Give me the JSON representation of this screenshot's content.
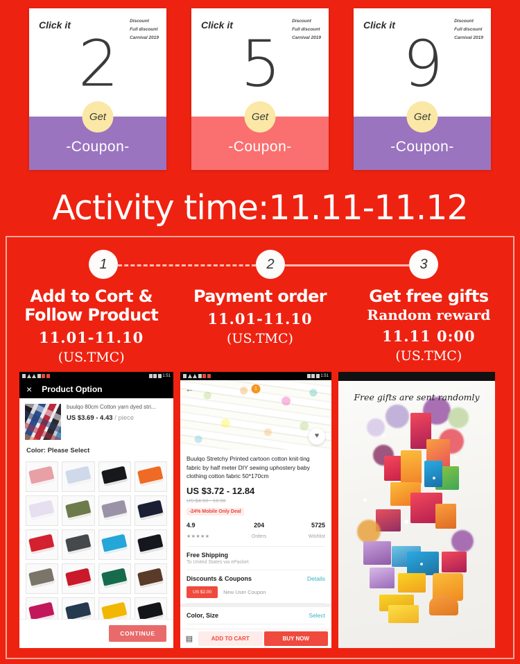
{
  "theme": {
    "background_red": "#ee2211",
    "purple": "#9a74bf",
    "coral": "#fa6f6f",
    "badge_yellow": "#fbe8a6",
    "frame_pink": "#f4a79b",
    "accent_orange_red": "#ef4a3d"
  },
  "coupons": [
    {
      "click_label": "Click it",
      "fineprint": [
        "Discount",
        "Full discount",
        "Carnival 2019"
      ],
      "amount": "2",
      "get_label": "Get",
      "coupon_label": "-Coupon-",
      "color": "purple"
    },
    {
      "click_label": "Click it",
      "fineprint": [
        "Discount",
        "Full discount",
        "Carnival 2019"
      ],
      "amount": "5",
      "get_label": "Get",
      "coupon_label": "-Coupon-",
      "color": "coral"
    },
    {
      "click_label": "Click it",
      "fineprint": [
        "Discount",
        "Full discount",
        "Carnival 2019"
      ],
      "amount": "9",
      "get_label": "Get",
      "coupon_label": "-Coupon-",
      "color": "purple"
    }
  ],
  "activity_time": "Activity time:11.11-11.12",
  "steps": [
    {
      "number": "1",
      "title": "Add to Cort &\nFollow Product",
      "subtitle": "",
      "date": "11.01-11.10",
      "region": "(US.TMC)"
    },
    {
      "number": "2",
      "title": "Payment order",
      "subtitle": "",
      "date": "11.01-11.10",
      "region": "(US.TMC)"
    },
    {
      "number": "3",
      "title": "Get free gifts",
      "subtitle": "Random reward",
      "date": "11.11  0:00",
      "region": "(US.TMC)"
    }
  ],
  "screenshot1": {
    "status_time": "1:51",
    "appbar_title": "Product Option",
    "close_icon": "×",
    "product_title": "buulqo 80cm Cotton yarn dyed stri...",
    "price": "US $3.69 - 4.43",
    "price_unit": "/ piece",
    "color_label": "Color: Please Select",
    "continue_label": "CONTINUE",
    "swatch_colors": [
      "#e8a0a6",
      "#cfd9ea",
      "#17181c",
      "#ef6a25",
      "#e6dff0",
      "#6d7a4a",
      "#9a93a8",
      "#1b1f33",
      "#d3222f",
      "#45494c",
      "#25a6d8",
      "#15171f",
      "#7b7468",
      "#c9192b",
      "#166b4c",
      "#5a3a28",
      "#c2185b",
      "#25394f",
      "#f2b705",
      "#141519"
    ]
  },
  "screenshot2": {
    "status_time": "1:51",
    "hero_badge": "1",
    "title": "Buulqo Stretchy Printed cartoon cotton knit-ting fabric by half meter DIY sewing uphostery baby clothing cotton fabric 50*170cm",
    "price": "US $3.72 - 12.84",
    "old_price": "US $4.90 - 16.90",
    "deal_badge": "-24% Mobile Only Deal",
    "stats": [
      {
        "value": "4.9",
        "label": "★★★★★",
        "is_stars": true
      },
      {
        "value": "204",
        "label": "Orders",
        "is_stars": false
      },
      {
        "value": "5725",
        "label": "Wishlist",
        "is_stars": false
      }
    ],
    "shipping_label": "Free Shipping",
    "shipping_sub": "To United States via ePacket",
    "discounts_label": "Discounts & Coupons",
    "details_link": "Details",
    "coupon_chip": "US $2.00",
    "coupon_note": "New User Coupon",
    "color_size_label": "Color, Size",
    "select_link": "Select",
    "add_to_cart": "ADD TO CART",
    "buy_now": "BUY NOW"
  },
  "screenshot3": {
    "caption": "Free gifts are sent randomly"
  }
}
